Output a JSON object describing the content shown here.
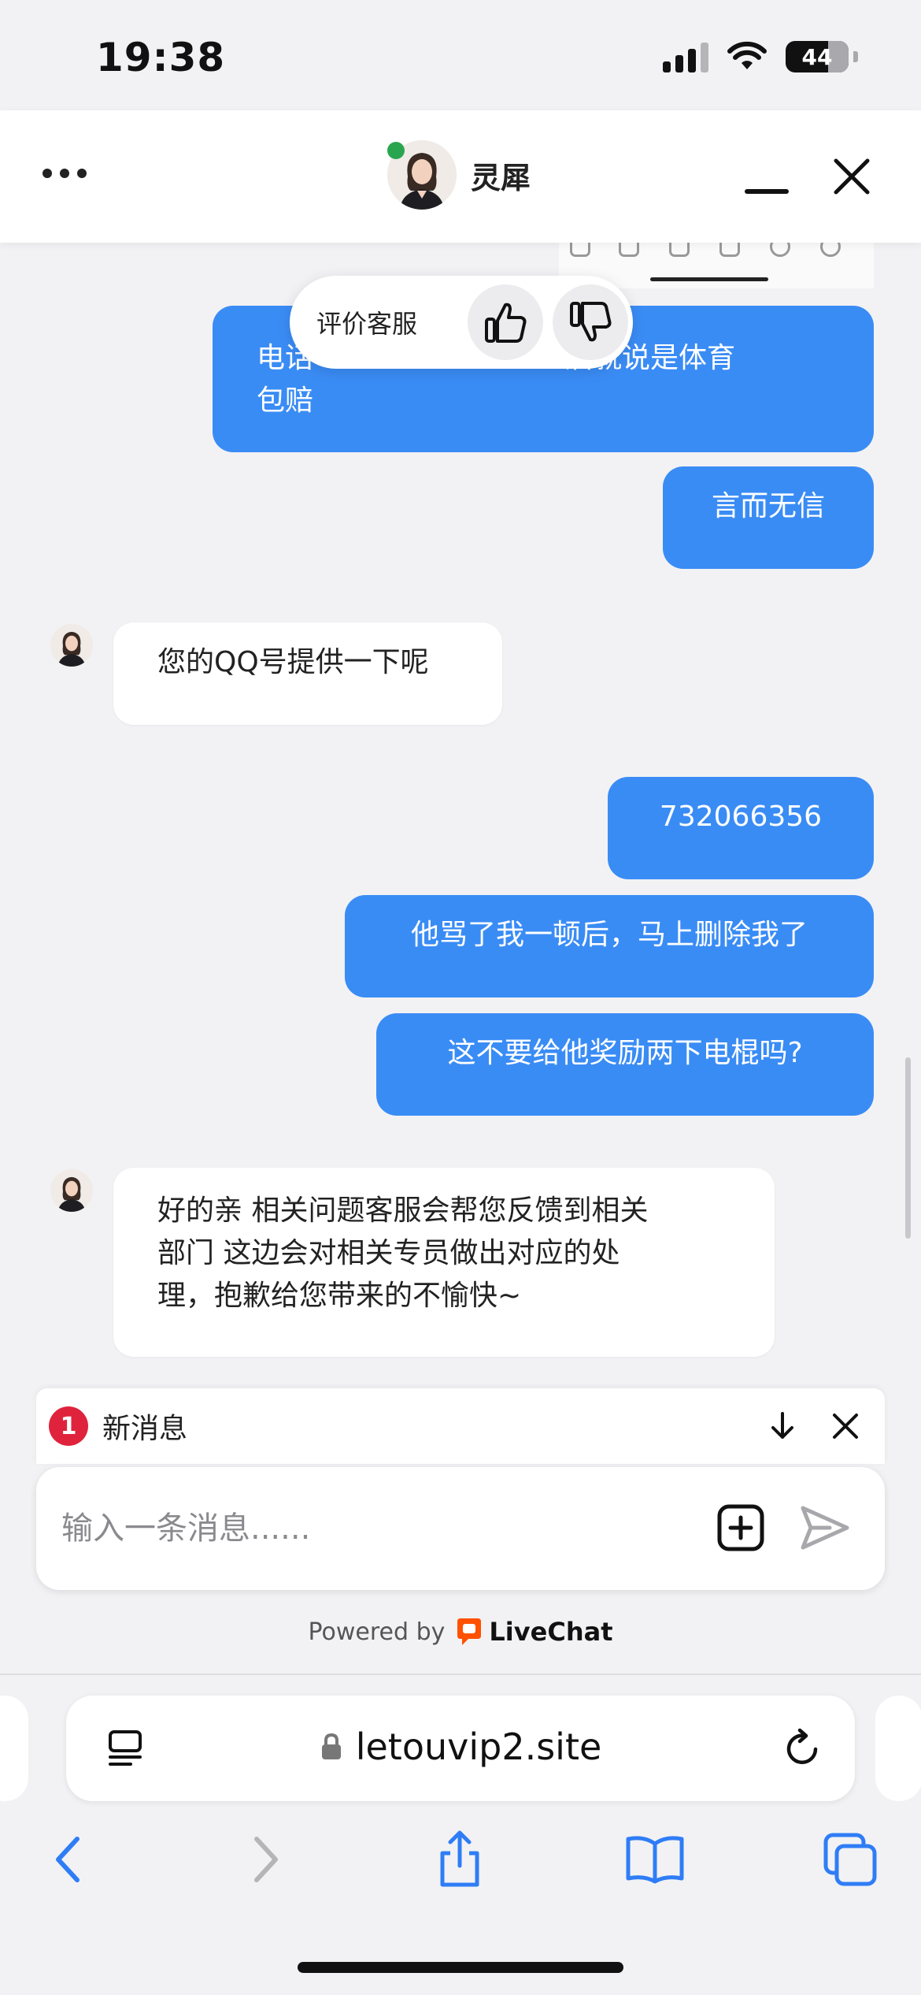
{
  "status_bar": {
    "time": "19:38",
    "battery": "44"
  },
  "header": {
    "agent_name": "灵犀"
  },
  "rating": {
    "label": "评价客服"
  },
  "messages": [
    {
      "dir": "out",
      "text": "电话【…】后就说是体育包赔",
      "visible_line1": "电话",
      "visible_line1b": "后就说是体育",
      "visible_line2": "包赔"
    },
    {
      "dir": "out",
      "text": "言而无信"
    },
    {
      "dir": "in",
      "text": "您的QQ号提供一下呢"
    },
    {
      "dir": "out",
      "text": "732066356"
    },
    {
      "dir": "out",
      "text": "他骂了我一顿后，马上删除我了"
    },
    {
      "dir": "out",
      "text": "这不要给他奖励两下电棍吗?"
    },
    {
      "dir": "in",
      "line1": "好的亲 相关问题客服会帮您反馈到相关",
      "line2": "部门 这边会对相关专员做出对应的处",
      "line3": "理，抱歉给您带来的不愉快~"
    }
  ],
  "new_message_bar": {
    "count": "1",
    "label": "新消息"
  },
  "composer": {
    "placeholder": "输入一条消息......"
  },
  "footer": {
    "powered_by": "Powered by",
    "brand": "LiveChat"
  },
  "browser": {
    "url": "letouvip2.site"
  },
  "colors": {
    "accent_blue": "#3a8cf5",
    "badge_red": "#e0233c",
    "online_green": "#2aa54f"
  }
}
